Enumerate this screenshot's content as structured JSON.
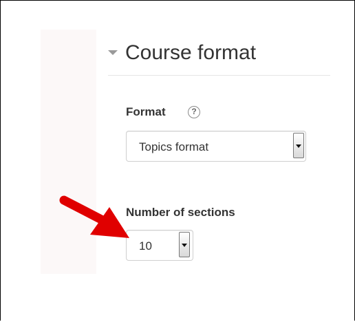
{
  "section": {
    "title": "Course format"
  },
  "format_field": {
    "label": "Format",
    "help_icon": "question-circle-icon",
    "selected_value": "Topics format"
  },
  "sections_field": {
    "label": "Number of sections",
    "selected_value": "10"
  },
  "annotation": {
    "arrow_color": "#e00000"
  }
}
